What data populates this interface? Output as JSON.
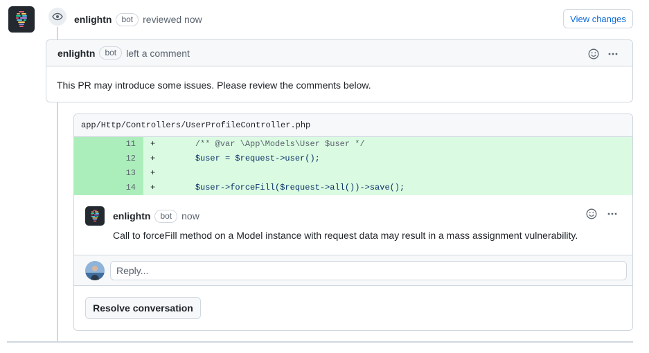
{
  "review": {
    "author": "enlightn",
    "badge": "bot",
    "action": "reviewed now",
    "view_changes_label": "View changes"
  },
  "comment": {
    "author": "enlightn",
    "badge": "bot",
    "action": "left a comment",
    "body": "This PR may introduce some issues. Please review the comments below."
  },
  "thread": {
    "file_path": "app/Http/Controllers/UserProfileController.php",
    "diff_lines": [
      {
        "number": "11",
        "sign": "+",
        "code": "        /** @var \\App\\Models\\User $user */"
      },
      {
        "number": "12",
        "sign": "+",
        "code": "        $user = $request->user();"
      },
      {
        "number": "13",
        "sign": "+",
        "code": ""
      },
      {
        "number": "14",
        "sign": "+",
        "code": "        $user->forceFill($request->all())->save();"
      }
    ],
    "inline_comment": {
      "author": "enlightn",
      "badge": "bot",
      "time": "now",
      "body": "Call to forceFill method on a Model instance with request data may result in a mass assignment vulnerability."
    },
    "reply_placeholder": "Reply...",
    "resolve_label": "Resolve conversation"
  },
  "icons": {
    "app_avatar": "enlightn-logo",
    "review_badge": "eye-icon",
    "reaction": "smiley-icon",
    "menu": "kebab-horizontal-icon",
    "user_avatar": "user-avatar-photo"
  },
  "colors": {
    "accent_link": "#0969da",
    "diff_added_bg": "#dafbe1",
    "diff_added_num_bg": "#aceebb",
    "border": "#d0d7de"
  }
}
